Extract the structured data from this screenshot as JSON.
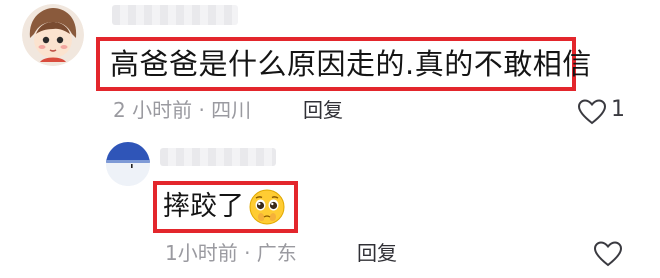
{
  "comments": [
    {
      "text": "高爸爸是什么原因走的.真的不敢相信",
      "meta": "2 小时前 · 四川",
      "reply_label": "回复",
      "likes": "1",
      "avatar_icon": "cartoon-girl-avatar",
      "highlight_color": "#e3262c"
    },
    {
      "text": "摔跤了",
      "emoji": "pleading-face-emoji",
      "meta": "1小时前 · 广东",
      "reply_label": "回复",
      "avatar_icon": "snowfield-avatar",
      "highlight_color": "#e3262c"
    }
  ]
}
